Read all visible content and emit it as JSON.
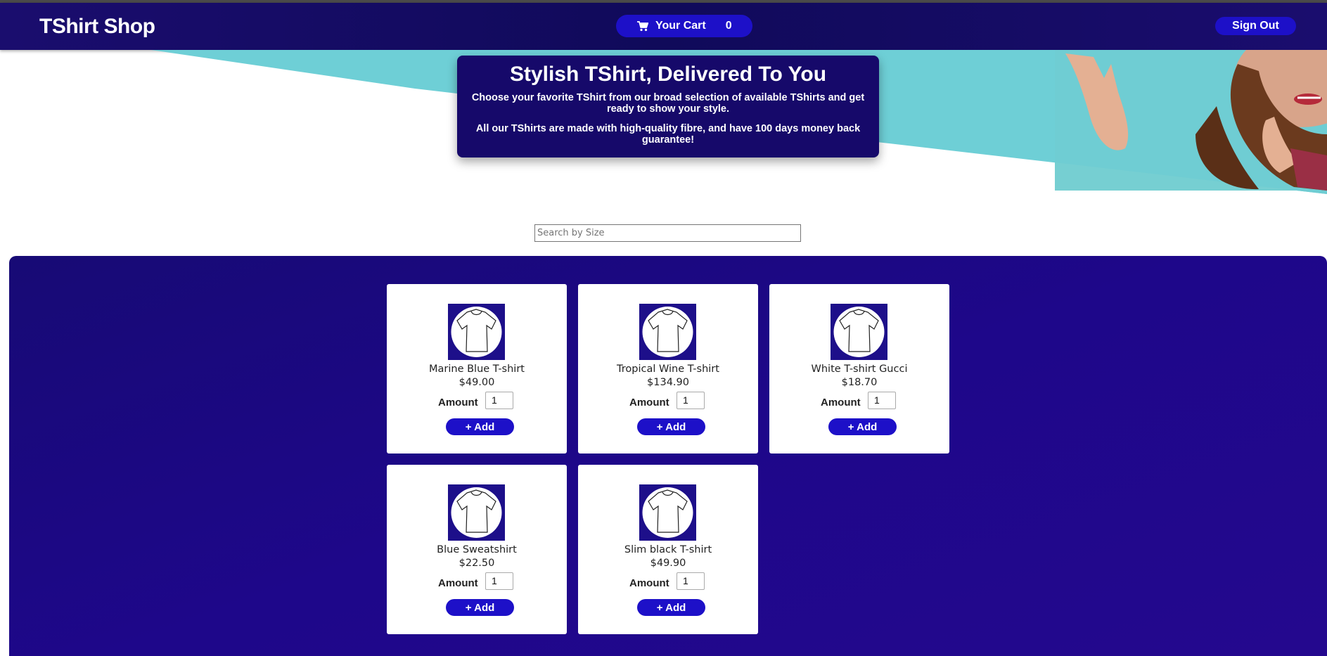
{
  "header": {
    "brand": "TShirt Shop",
    "cart_label": "Your Cart",
    "cart_count": "0",
    "cart_icon": "cart-icon",
    "signout_label": "Sign Out"
  },
  "hero": {
    "title": "Stylish TShirt, Delivered To You",
    "text1": "Choose your favorite TShirt from our broad selection of available TShirts and get ready to show your style.",
    "text2": "All our TShirts are made with high-quality fibre, and have 100 days money back guarantee!"
  },
  "search": {
    "placeholder": "Search by Size",
    "value": ""
  },
  "products": {
    "amount_label": "Amount",
    "add_label": "+ Add",
    "items": [
      {
        "name": "Marine Blue T-shirt",
        "price": "$49.00",
        "amount": "1"
      },
      {
        "name": "Tropical Wine T-shirt",
        "price": "$134.90",
        "amount": "1"
      },
      {
        "name": "White T-shirt Gucci",
        "price": "$18.70",
        "amount": "1"
      },
      {
        "name": "Blue Sweatshirt",
        "price": "$22.50",
        "amount": "1"
      },
      {
        "name": "Slim black T-shirt",
        "price": "$49.90",
        "amount": "1"
      }
    ]
  },
  "colors": {
    "header_bg": "#120b62",
    "accent": "#1d10c8",
    "panel_bg": "#1e078a",
    "teal": "#6ecfd6"
  }
}
